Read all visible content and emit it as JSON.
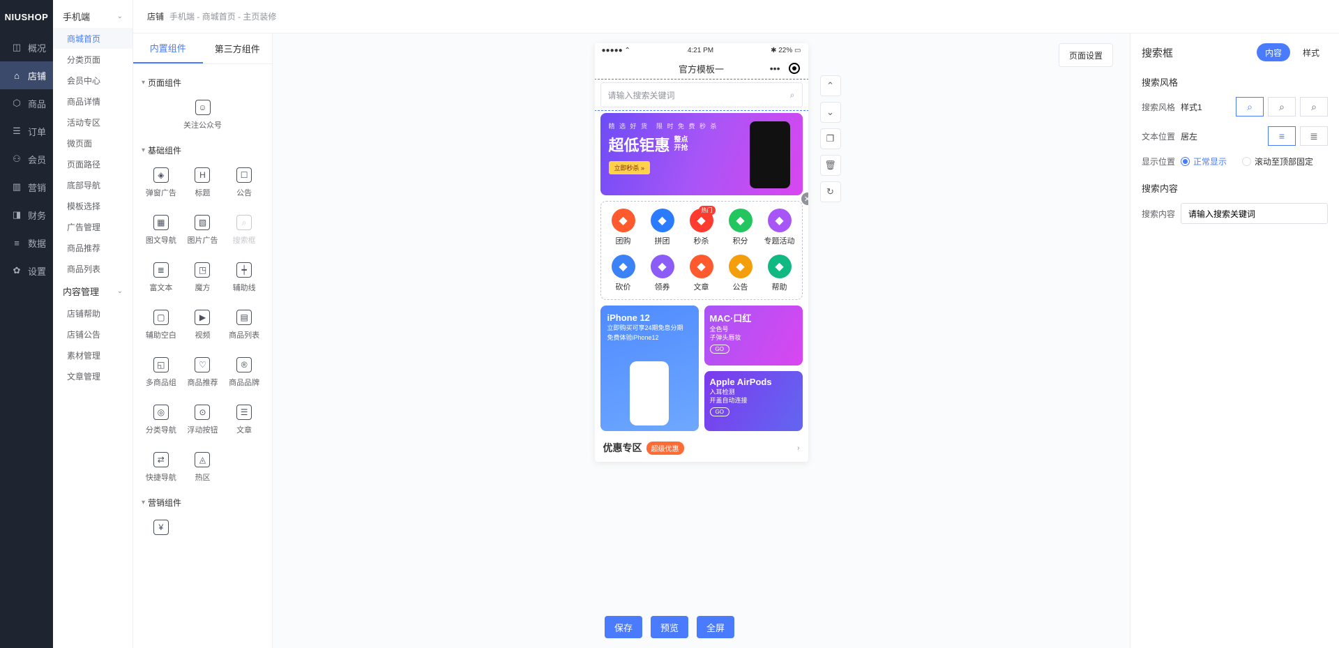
{
  "logo": "NIUSHOP",
  "nav": [
    {
      "label": "概况",
      "icon": "◫"
    },
    {
      "label": "店铺",
      "icon": "⌂",
      "active": true
    },
    {
      "label": "商品",
      "icon": "⬡"
    },
    {
      "label": "订单",
      "icon": "☰"
    },
    {
      "label": "会员",
      "icon": "⚇"
    },
    {
      "label": "营销",
      "icon": "▥"
    },
    {
      "label": "财务",
      "icon": "◨"
    },
    {
      "label": "数据",
      "icon": "≡"
    },
    {
      "label": "设置",
      "icon": "✿"
    }
  ],
  "breadcrumb": {
    "tab": "店铺",
    "items": [
      "手机端",
      "商城首页",
      "主页装修"
    ]
  },
  "sidebar": {
    "head": "手机端",
    "groups": [
      {
        "cat": null,
        "items": [
          {
            "label": "商城首页",
            "active": true
          },
          {
            "label": "分类页面"
          },
          {
            "label": "会员中心"
          },
          {
            "label": "商品详情"
          },
          {
            "label": "活动专区"
          },
          {
            "label": "微页面"
          },
          {
            "label": "页面路径"
          },
          {
            "label": "底部导航"
          },
          {
            "label": "模板选择"
          },
          {
            "label": "广告管理"
          },
          {
            "label": "商品推荐"
          },
          {
            "label": "商品列表"
          }
        ]
      },
      {
        "cat": "内容管理",
        "items": [
          {
            "label": "店铺帮助"
          },
          {
            "label": "店铺公告"
          },
          {
            "label": "素材管理"
          },
          {
            "label": "文章管理"
          }
        ]
      }
    ]
  },
  "compTabs": [
    "内置组件",
    "第三方组件"
  ],
  "compGroups": [
    {
      "title": "页面组件",
      "cols": 1,
      "items": [
        {
          "label": "关注公众号",
          "icon": "☺"
        }
      ]
    },
    {
      "title": "基础组件",
      "cols": 3,
      "items": [
        {
          "label": "弹窗广告",
          "icon": "◈"
        },
        {
          "label": "标题",
          "icon": "H"
        },
        {
          "label": "公告",
          "icon": "☐"
        },
        {
          "label": "图文导航",
          "icon": "▦"
        },
        {
          "label": "图片广告",
          "icon": "▧"
        },
        {
          "label": "搜索框",
          "icon": "⌕",
          "dis": true
        },
        {
          "label": "富文本",
          "icon": "≣"
        },
        {
          "label": "魔方",
          "icon": "◳"
        },
        {
          "label": "辅助线",
          "icon": "┿"
        },
        {
          "label": "辅助空白",
          "icon": "▢"
        },
        {
          "label": "视频",
          "icon": "▶"
        },
        {
          "label": "商品列表",
          "icon": "▤"
        },
        {
          "label": "多商品组",
          "icon": "◱"
        },
        {
          "label": "商品推荐",
          "icon": "♡"
        },
        {
          "label": "商品品牌",
          "icon": "®"
        },
        {
          "label": "分类导航",
          "icon": "◎"
        },
        {
          "label": "浮动按钮",
          "icon": "⊙"
        },
        {
          "label": "文章",
          "icon": "☰"
        },
        {
          "label": "快捷导航",
          "icon": "⇄"
        },
        {
          "label": "热区",
          "icon": "◬"
        }
      ]
    },
    {
      "title": "营销组件",
      "cols": 3,
      "items": [
        {
          "label": "",
          "icon": "¥"
        }
      ]
    }
  ],
  "phone": {
    "time": "4:21 PM",
    "battery": "22%",
    "title": "官方模板一",
    "search_ph": "请输入搜索关键词",
    "banner": {
      "small": "精 选 好 货　限 时 免 费 秒 杀",
      "big": "超低钜惠",
      "tag1": "整点",
      "tag2": "开抢",
      "btn": "立即秒杀 »"
    },
    "navs": [
      {
        "label": "团购",
        "color": "#ff5a2e"
      },
      {
        "label": "拼团",
        "color": "#2b7bff"
      },
      {
        "label": "秒杀",
        "color": "#ff3b30",
        "hot": "热门"
      },
      {
        "label": "积分",
        "color": "#22c55e"
      },
      {
        "label": "专题活动",
        "color": "#a855f7"
      },
      {
        "label": "砍价",
        "color": "#3b82f6"
      },
      {
        "label": "领券",
        "color": "#8b5cf6"
      },
      {
        "label": "文章",
        "color": "#ff5a2e"
      },
      {
        "label": "公告",
        "color": "#f59e0b"
      },
      {
        "label": "帮助",
        "color": "#10b981"
      }
    ],
    "mf": {
      "l": {
        "t": "iPhone 12",
        "s1": "立即购买可享24期免息分期",
        "s2": "免费体验iPhone12"
      },
      "r1": {
        "t": "MAC·口红",
        "s1": "全色号",
        "s2": "子弹头唇妆",
        "go": "GO"
      },
      "r2": {
        "t": "Apple AirPods",
        "s1": "入耳检测",
        "s2": "开盖自动连接",
        "go": "GO"
      }
    },
    "titleSec": {
      "t": "优惠专区",
      "tag": "超级优惠"
    }
  },
  "labels": {
    "search": "搜索框",
    "img": "图片广告",
    "nav": "图文导航",
    "mf": "魔方",
    "title": "标题"
  },
  "pageSet": "页面设置",
  "controls": [
    "⌃",
    "⌄",
    "❐",
    "🗑",
    "↻"
  ],
  "actions": {
    "save": "保存",
    "preview": "预览",
    "full": "全屏"
  },
  "props": {
    "title": "搜索框",
    "tabs": [
      "内容",
      "样式"
    ],
    "sec1": {
      "h": "搜索风格",
      "style_label": "搜索风格",
      "style_value": "样式1",
      "text_label": "文本位置",
      "text_value": "居左",
      "pos_label": "显示位置",
      "pos_opts": [
        "正常显示",
        "滚动至顶部固定"
      ]
    },
    "sec2": {
      "h": "搜索内容",
      "label": "搜索内容",
      "ph": "请输入搜索关键词"
    }
  }
}
